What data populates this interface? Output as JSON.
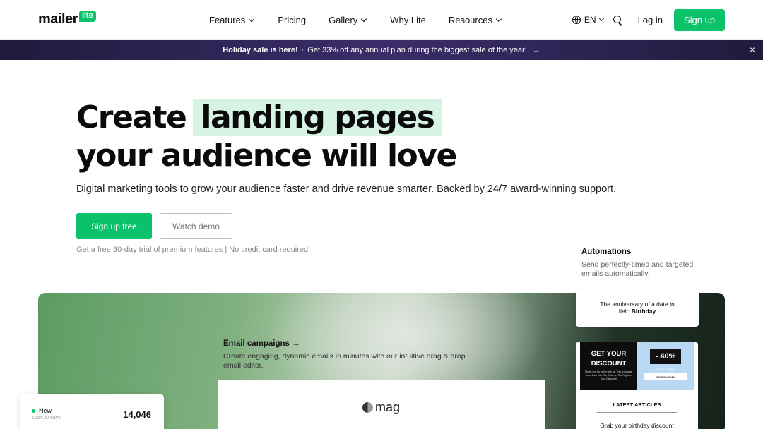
{
  "header": {
    "logo": {
      "word": "mailer",
      "badge": "lite"
    },
    "nav": [
      {
        "label": "Features",
        "has_dropdown": true
      },
      {
        "label": "Pricing",
        "has_dropdown": false
      },
      {
        "label": "Gallery",
        "has_dropdown": true
      },
      {
        "label": "Why Lite",
        "has_dropdown": false
      },
      {
        "label": "Resources",
        "has_dropdown": true
      }
    ],
    "language": "EN",
    "login_label": "Log in",
    "signup_label": "Sign up"
  },
  "banner": {
    "headline": "Holiday sale is here!",
    "separator": "·",
    "text": "Get 33% off any annual plan during the biggest sale of the year!",
    "arrow": "→",
    "close": "×"
  },
  "hero": {
    "title_start": "Create",
    "title_highlight": "landing pages",
    "title_end": "your audience will love",
    "subtitle": "Digital marketing tools to grow your audience faster and drive revenue smarter. Backed by 24/7 award-winning support.",
    "primary_cta": "Sign up free",
    "secondary_cta": "Watch demo",
    "trial_note": "Get a free 30-day trial of premium features | No credit card required"
  },
  "automations": {
    "title": "Automations →",
    "description": "Send perfectly-timed and targeted emails automatically."
  },
  "showcase": {
    "email_campaigns_title": "Email campaigns →",
    "email_campaigns_desc": "Create engaging, dynamic emails in minutes with our intuitive drag & drop email editor.",
    "mag_logo": "mag",
    "stats": {
      "label": "New",
      "sub": "Last 30 days",
      "value": "14,046"
    },
    "trigger": {
      "line1": "The anniversary of a date in",
      "line2_prefix": "field ",
      "line2_bold": "Birthday"
    },
    "email_preview": {
      "discount_title": "GET YOUR DISCOUNT",
      "discount_small": "Thank you for being with us. This is how we show love! Use The Code on The Right on Your Discount!",
      "percent": "- 40%",
      "code_label": "CODE TO USE",
      "code": "DISCOUNT40",
      "section_title": "LATEST ARTICLES"
    },
    "grab_text": "Grab your birthday discount"
  },
  "colors": {
    "brand_green": "#09c269",
    "highlight": "#d6f3e3",
    "banner_bg": "#2d2552"
  }
}
